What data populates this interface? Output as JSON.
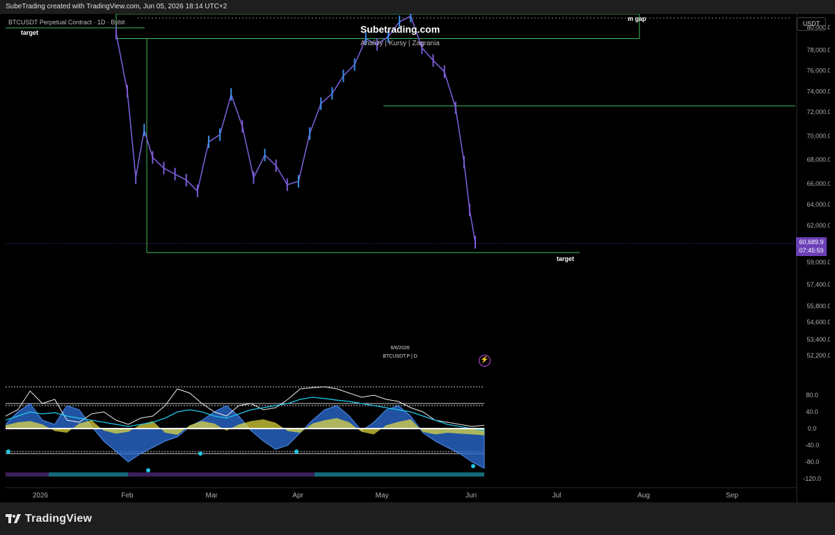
{
  "header": {
    "text": "SubeTrading created with TradingView.com, Jun 05, 2026 18:14 UTC+2"
  },
  "symbol": "BTCUSDT Perpetual Contract · 1D · Bybit",
  "annotations": {
    "target_top": "target",
    "gap_label": "m gap",
    "target_bottom": "target"
  },
  "watermark": {
    "title": "Subetrading.com",
    "subtitle": "Analizy | Kursy | Zagrania"
  },
  "currency": "USDT",
  "last_price": {
    "value": "60,689.9",
    "countdown": "07:45:59"
  },
  "subpane": {
    "date": "6/6/2026",
    "label": "BTCUSDT.P | D"
  },
  "footer": {
    "logo_text": "TradingView"
  },
  "colors": {
    "candle": "#7b5cd6",
    "candle_up": "#3b8ee8",
    "level_line": "#3fbf5f",
    "price_badge": "#6b3fb6",
    "osc_blue": "#2e6fd8",
    "osc_cyan": "#1fc8e8",
    "osc_yellow": "#e8e040",
    "osc_purple": "#8a40d0"
  },
  "chart_data": {
    "type": "line",
    "title": "BTCUSDT Perpetual Contract · 1D · Bybit",
    "price_axis": {
      "ticks": [
        "80,000.0",
        "78,000.0",
        "76,000.0",
        "74,000.0",
        "72,000.0",
        "70,000.0",
        "68,000.0",
        "66,000.0",
        "64,000.0",
        "62,000.0",
        "59,000.0",
        "57,400.0",
        "55,800.0",
        "54,600.0",
        "53,400.0",
        "52,200.0"
      ]
    },
    "oscillator_axis": {
      "ticks": [
        "80.0",
        "40.0",
        "0.0",
        "-40.0",
        "-80.0",
        "-120.0"
      ]
    },
    "time_axis": {
      "ticks": [
        "2026",
        "Feb",
        "Mar",
        "Apr",
        "May",
        "Jun",
        "Jul",
        "Aug",
        "Sep"
      ]
    },
    "ylim": [
      52200,
      81200
    ],
    "levels": [
      {
        "price": 72600,
        "label": ""
      },
      {
        "price": 59900,
        "label": "target"
      }
    ],
    "gap_zone": {
      "top": 81200,
      "bottom": 79200,
      "label": "m gap"
    },
    "series": [
      {
        "name": "BTCUSDT",
        "x": [
          "2026-01-28",
          "2026-02-01",
          "2026-02-04",
          "2026-02-07",
          "2026-02-10",
          "2026-02-14",
          "2026-02-18",
          "2026-02-22",
          "2026-02-26",
          "2026-03-02",
          "2026-03-06",
          "2026-03-10",
          "2026-03-14",
          "2026-03-18",
          "2026-03-22",
          "2026-03-26",
          "2026-03-30",
          "2026-04-03",
          "2026-04-07",
          "2026-04-11",
          "2026-04-15",
          "2026-04-19",
          "2026-04-23",
          "2026-04-27",
          "2026-05-01",
          "2026-05-05",
          "2026-05-09",
          "2026-05-13",
          "2026-05-17",
          "2026-05-21",
          "2026-05-25",
          "2026-05-29",
          "2026-06-01",
          "2026-06-03",
          "2026-06-05"
        ],
        "values": [
          79500,
          74000,
          66500,
          70500,
          68200,
          67300,
          66800,
          66300,
          65300,
          69500,
          70100,
          73700,
          70800,
          66500,
          68400,
          67500,
          65900,
          66200,
          70200,
          72800,
          73800,
          75500,
          76600,
          79000,
          78500,
          79200,
          80500,
          81000,
          78200,
          77000,
          75900,
          72400,
          67800,
          63500,
          60690
        ]
      }
    ]
  }
}
